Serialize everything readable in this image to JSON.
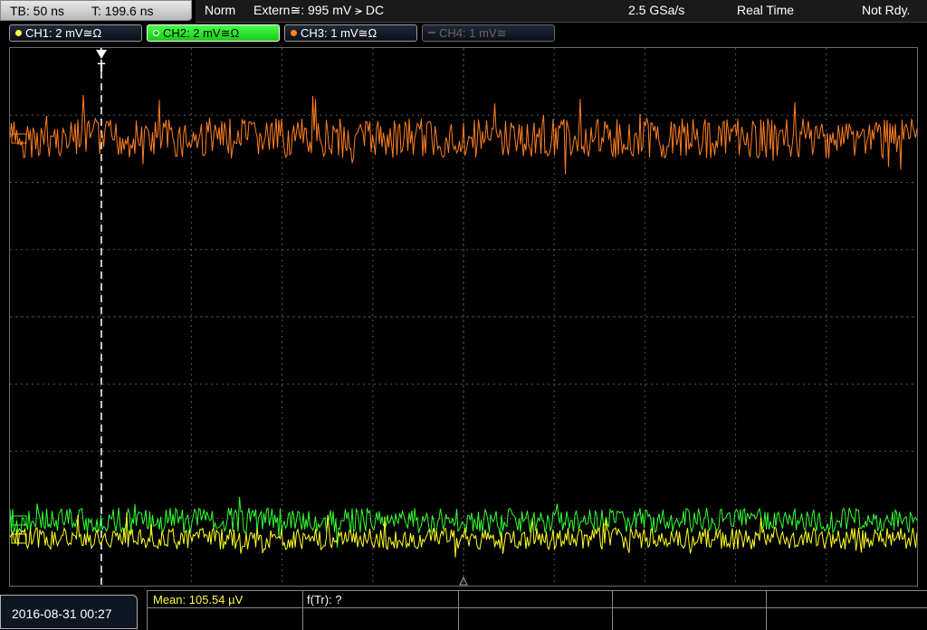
{
  "header": {
    "timebase": "TB: 50 ns",
    "trigger_time": "T: 199.6 ns",
    "trigger_mode": "Norm",
    "trigger_source": "Extern≅: 995 mV ⪫ DC",
    "sample_rate": "2.5 GSa/s",
    "acq_mode": "Real Time",
    "status": "Not Rdy."
  },
  "channels": [
    {
      "label": "CH1: 2 mV≅Ω",
      "color": "#ffff40",
      "state": "on"
    },
    {
      "label": "CH2: 2 mV≅Ω",
      "color": "#38ff38",
      "state": "active"
    },
    {
      "label": "CH3: 1 mV≅Ω",
      "color": "#ff8020",
      "state": "on"
    },
    {
      "label": "CH4: 1 mV≅",
      "color": "#777777",
      "state": "off"
    }
  ],
  "trigger_marker": "T",
  "footer": {
    "datetime": "2016-08-31 00:27",
    "mean": "Mean: 105.54 µV",
    "freq": "f(Tr): ?"
  },
  "colors": {
    "ch1": "#ffff20",
    "ch2": "#30ff30",
    "ch3": "#ff7f20",
    "grid": "#555555"
  }
}
